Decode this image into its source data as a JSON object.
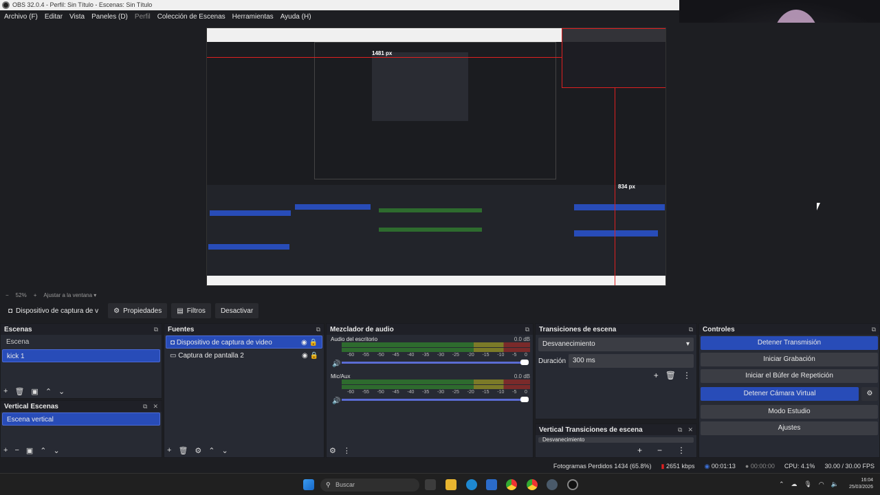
{
  "window": {
    "title": "OBS 32.0.4 - Perfil: Sin Título - Escenas: Sin Título"
  },
  "menu": [
    "Archivo (F)",
    "Editar",
    "Vista",
    "Paneles (D)",
    "Perfil",
    "Colección de Escenas",
    "Herramientas",
    "Ayuda (H)"
  ],
  "preview": {
    "width_label": "1481 px",
    "height_label": "834 px"
  },
  "zoom": {
    "minus": "−",
    "value": "52%",
    "plus": "+",
    "fit": "Ajustar a la ventana"
  },
  "source_toolbar": {
    "source": "Dispositivo de captura de v",
    "properties": "Propiedades",
    "filters": "Filtros",
    "deactivate": "Desactivar"
  },
  "scenes": {
    "title": "Escenas",
    "header": "Escena",
    "items": [
      "kick 1"
    ]
  },
  "vertical_scenes": {
    "title": "Vertical Escenas",
    "items": [
      "Escena vertical"
    ]
  },
  "sources": {
    "title": "Fuentes",
    "items": [
      "Dispositivo de captura de video",
      "Captura de pantalla 2"
    ]
  },
  "mixer": {
    "title": "Mezclador de audio",
    "channels": [
      {
        "name": "Audio del escritorio",
        "db": "0.0 dB"
      },
      {
        "name": "Mic/Aux",
        "db": "0.0 dB"
      }
    ],
    "ticks": [
      "-60",
      "-55",
      "-50",
      "-45",
      "-40",
      "-35",
      "-30",
      "-25",
      "-20",
      "-15",
      "-10",
      "-5",
      "0"
    ]
  },
  "transitions": {
    "title": "Transiciones de escena",
    "selected": "Desvanecimiento",
    "duration_label": "Duración",
    "duration_value": "300 ms"
  },
  "vertical_transitions": {
    "title": "Vertical Transiciones de escena",
    "selected": "Desvanecimiento"
  },
  "controls": {
    "title": "Controles",
    "buttons": [
      "Detener Transmisión",
      "Iniciar Grabación",
      "Iniciar el Búfer de Repetición",
      "Detener Cámara Virtual",
      "Modo Estudio",
      "Ajustes"
    ]
  },
  "status": {
    "dropped": "Fotogramas Perdidos 1434 (65.8%)",
    "bitrate": "2651 kbps",
    "stream_time": "00:01:13",
    "rec_time": "00:00:00",
    "cpu": "CPU: 4.1%",
    "fps": "30.00 / 30.00 FPS"
  },
  "taskbar": {
    "search": "Buscar",
    "time": "16:04",
    "date": "25/03/2026"
  }
}
